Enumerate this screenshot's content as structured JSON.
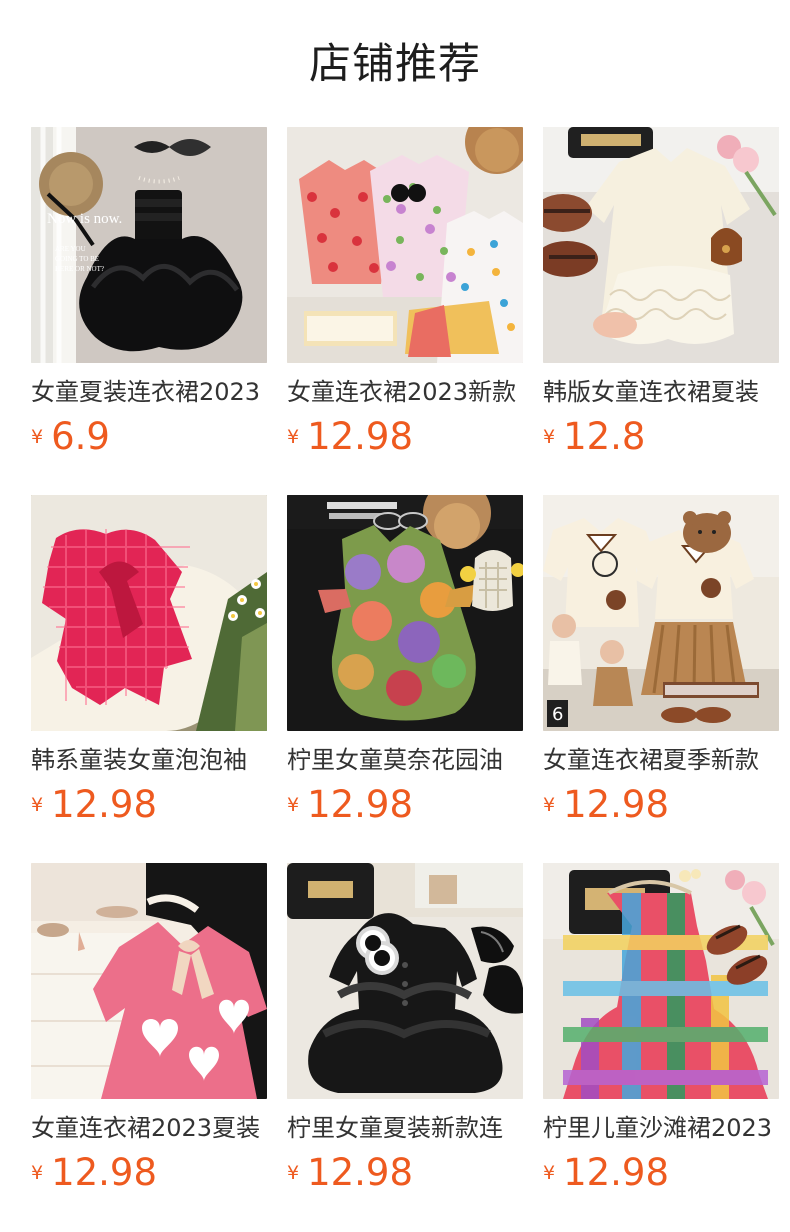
{
  "page": {
    "section_title": "店铺推荐"
  },
  "products": [
    {
      "title": "女童夏装连衣裙2023",
      "currency": "¥",
      "price": "6.9",
      "image_name": "black-tutu-dress-photo",
      "image_text": {
        "line1": "Now is now.",
        "line2": "ARE YOU",
        "line3": "GOING TO BE",
        "line4": "HERE OR NOT?"
      }
    },
    {
      "title": "女童连衣裙2023新款",
      "currency": "¥",
      "price": "12.98",
      "image_name": "floral-dresses-photo"
    },
    {
      "title": "韩版女童连衣裙夏装",
      "currency": "¥",
      "price": "12.8",
      "image_name": "cream-lace-dress-photo"
    },
    {
      "title": "韩系童装女童泡泡袖",
      "currency": "¥",
      "price": "12.98",
      "image_name": "pink-check-dress-photo"
    },
    {
      "title": "柠里女童莫奈花园油",
      "currency": "¥",
      "price": "12.98",
      "image_name": "monet-floral-dress-photo"
    },
    {
      "title": "女童连衣裙夏季新款",
      "currency": "¥",
      "price": "12.98",
      "image_name": "bear-polo-dresses-photo"
    },
    {
      "title": "女童连衣裙2023夏装",
      "currency": "¥",
      "price": "12.98",
      "image_name": "pink-heart-dress-photo"
    },
    {
      "title": "柠里女童夏装新款连",
      "currency": "¥",
      "price": "12.98",
      "image_name": "black-ruffle-dress-photo"
    },
    {
      "title": "柠里儿童沙滩裙2023",
      "currency": "¥",
      "price": "12.98",
      "image_name": "plaid-beach-dress-photo"
    }
  ],
  "colors": {
    "price": "#ee5a1f",
    "title": "#333333",
    "heading": "#1d1d1d"
  }
}
